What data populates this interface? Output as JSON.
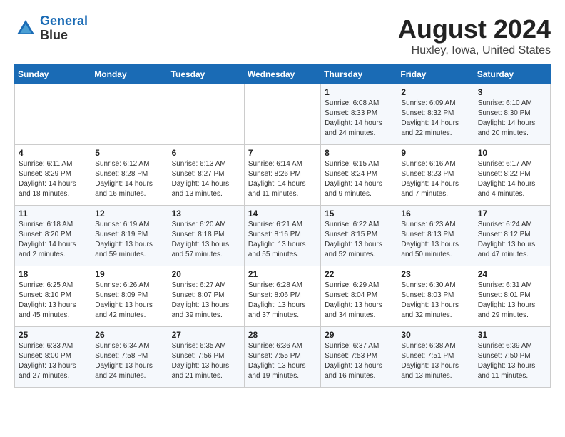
{
  "header": {
    "logo_line1": "General",
    "logo_line2": "Blue",
    "month_year": "August 2024",
    "location": "Huxley, Iowa, United States"
  },
  "days_of_week": [
    "Sunday",
    "Monday",
    "Tuesday",
    "Wednesday",
    "Thursday",
    "Friday",
    "Saturday"
  ],
  "weeks": [
    [
      {
        "day": "",
        "info": ""
      },
      {
        "day": "",
        "info": ""
      },
      {
        "day": "",
        "info": ""
      },
      {
        "day": "",
        "info": ""
      },
      {
        "day": "1",
        "info": "Sunrise: 6:08 AM\nSunset: 8:33 PM\nDaylight: 14 hours\nand 24 minutes."
      },
      {
        "day": "2",
        "info": "Sunrise: 6:09 AM\nSunset: 8:32 PM\nDaylight: 14 hours\nand 22 minutes."
      },
      {
        "day": "3",
        "info": "Sunrise: 6:10 AM\nSunset: 8:30 PM\nDaylight: 14 hours\nand 20 minutes."
      }
    ],
    [
      {
        "day": "4",
        "info": "Sunrise: 6:11 AM\nSunset: 8:29 PM\nDaylight: 14 hours\nand 18 minutes."
      },
      {
        "day": "5",
        "info": "Sunrise: 6:12 AM\nSunset: 8:28 PM\nDaylight: 14 hours\nand 16 minutes."
      },
      {
        "day": "6",
        "info": "Sunrise: 6:13 AM\nSunset: 8:27 PM\nDaylight: 14 hours\nand 13 minutes."
      },
      {
        "day": "7",
        "info": "Sunrise: 6:14 AM\nSunset: 8:26 PM\nDaylight: 14 hours\nand 11 minutes."
      },
      {
        "day": "8",
        "info": "Sunrise: 6:15 AM\nSunset: 8:24 PM\nDaylight: 14 hours\nand 9 minutes."
      },
      {
        "day": "9",
        "info": "Sunrise: 6:16 AM\nSunset: 8:23 PM\nDaylight: 14 hours\nand 7 minutes."
      },
      {
        "day": "10",
        "info": "Sunrise: 6:17 AM\nSunset: 8:22 PM\nDaylight: 14 hours\nand 4 minutes."
      }
    ],
    [
      {
        "day": "11",
        "info": "Sunrise: 6:18 AM\nSunset: 8:20 PM\nDaylight: 14 hours\nand 2 minutes."
      },
      {
        "day": "12",
        "info": "Sunrise: 6:19 AM\nSunset: 8:19 PM\nDaylight: 13 hours\nand 59 minutes."
      },
      {
        "day": "13",
        "info": "Sunrise: 6:20 AM\nSunset: 8:18 PM\nDaylight: 13 hours\nand 57 minutes."
      },
      {
        "day": "14",
        "info": "Sunrise: 6:21 AM\nSunset: 8:16 PM\nDaylight: 13 hours\nand 55 minutes."
      },
      {
        "day": "15",
        "info": "Sunrise: 6:22 AM\nSunset: 8:15 PM\nDaylight: 13 hours\nand 52 minutes."
      },
      {
        "day": "16",
        "info": "Sunrise: 6:23 AM\nSunset: 8:13 PM\nDaylight: 13 hours\nand 50 minutes."
      },
      {
        "day": "17",
        "info": "Sunrise: 6:24 AM\nSunset: 8:12 PM\nDaylight: 13 hours\nand 47 minutes."
      }
    ],
    [
      {
        "day": "18",
        "info": "Sunrise: 6:25 AM\nSunset: 8:10 PM\nDaylight: 13 hours\nand 45 minutes."
      },
      {
        "day": "19",
        "info": "Sunrise: 6:26 AM\nSunset: 8:09 PM\nDaylight: 13 hours\nand 42 minutes."
      },
      {
        "day": "20",
        "info": "Sunrise: 6:27 AM\nSunset: 8:07 PM\nDaylight: 13 hours\nand 39 minutes."
      },
      {
        "day": "21",
        "info": "Sunrise: 6:28 AM\nSunset: 8:06 PM\nDaylight: 13 hours\nand 37 minutes."
      },
      {
        "day": "22",
        "info": "Sunrise: 6:29 AM\nSunset: 8:04 PM\nDaylight: 13 hours\nand 34 minutes."
      },
      {
        "day": "23",
        "info": "Sunrise: 6:30 AM\nSunset: 8:03 PM\nDaylight: 13 hours\nand 32 minutes."
      },
      {
        "day": "24",
        "info": "Sunrise: 6:31 AM\nSunset: 8:01 PM\nDaylight: 13 hours\nand 29 minutes."
      }
    ],
    [
      {
        "day": "25",
        "info": "Sunrise: 6:33 AM\nSunset: 8:00 PM\nDaylight: 13 hours\nand 27 minutes."
      },
      {
        "day": "26",
        "info": "Sunrise: 6:34 AM\nSunset: 7:58 PM\nDaylight: 13 hours\nand 24 minutes."
      },
      {
        "day": "27",
        "info": "Sunrise: 6:35 AM\nSunset: 7:56 PM\nDaylight: 13 hours\nand 21 minutes."
      },
      {
        "day": "28",
        "info": "Sunrise: 6:36 AM\nSunset: 7:55 PM\nDaylight: 13 hours\nand 19 minutes."
      },
      {
        "day": "29",
        "info": "Sunrise: 6:37 AM\nSunset: 7:53 PM\nDaylight: 13 hours\nand 16 minutes."
      },
      {
        "day": "30",
        "info": "Sunrise: 6:38 AM\nSunset: 7:51 PM\nDaylight: 13 hours\nand 13 minutes."
      },
      {
        "day": "31",
        "info": "Sunrise: 6:39 AM\nSunset: 7:50 PM\nDaylight: 13 hours\nand 11 minutes."
      }
    ]
  ]
}
